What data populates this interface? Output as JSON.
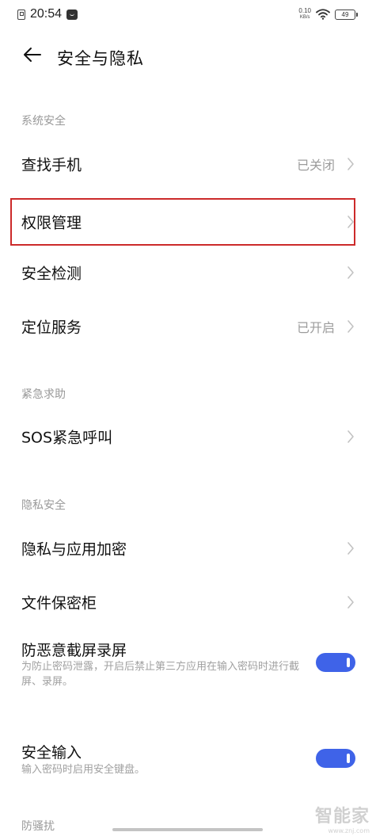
{
  "status_bar": {
    "time": "20:54",
    "net_speed_value": "0.10",
    "net_speed_unit": "KB/s",
    "battery": "49",
    "icons": [
      "sim-icon",
      "notification-icon",
      "wifi-icon",
      "battery-icon"
    ]
  },
  "header": {
    "title": "安全与隐私",
    "back_icon": "arrow-left-icon"
  },
  "sections": {
    "system_security": {
      "header": "系统安全",
      "items": [
        {
          "label": "查找手机",
          "value": "已关闭"
        },
        {
          "label": "权限管理"
        },
        {
          "label": "安全检测"
        },
        {
          "label": "定位服务",
          "value": "已开启"
        }
      ]
    },
    "emergency": {
      "header": "紧急求助",
      "items": [
        {
          "label": "SOS紧急呼叫"
        }
      ]
    },
    "privacy": {
      "header": "隐私安全",
      "items": [
        {
          "label": "隐私与应用加密"
        },
        {
          "label": "文件保密柜"
        }
      ],
      "toggles": [
        {
          "title": "防恶意截屏录屏",
          "desc": "为防止密码泄露，开启后禁止第三方应用在输入密码时进行截屏、录屏。",
          "enabled": true
        },
        {
          "title": "安全输入",
          "desc": "输入密码时启用安全键盘。",
          "enabled": true
        }
      ]
    },
    "anti_harassment": {
      "header": "防骚扰"
    }
  },
  "watermark": {
    "main": "智能家",
    "sub": "www.znj.com"
  },
  "colors": {
    "accent": "#3f63e8",
    "highlight": "#cc2a2a",
    "secondary_text": "#9c9c9c"
  }
}
